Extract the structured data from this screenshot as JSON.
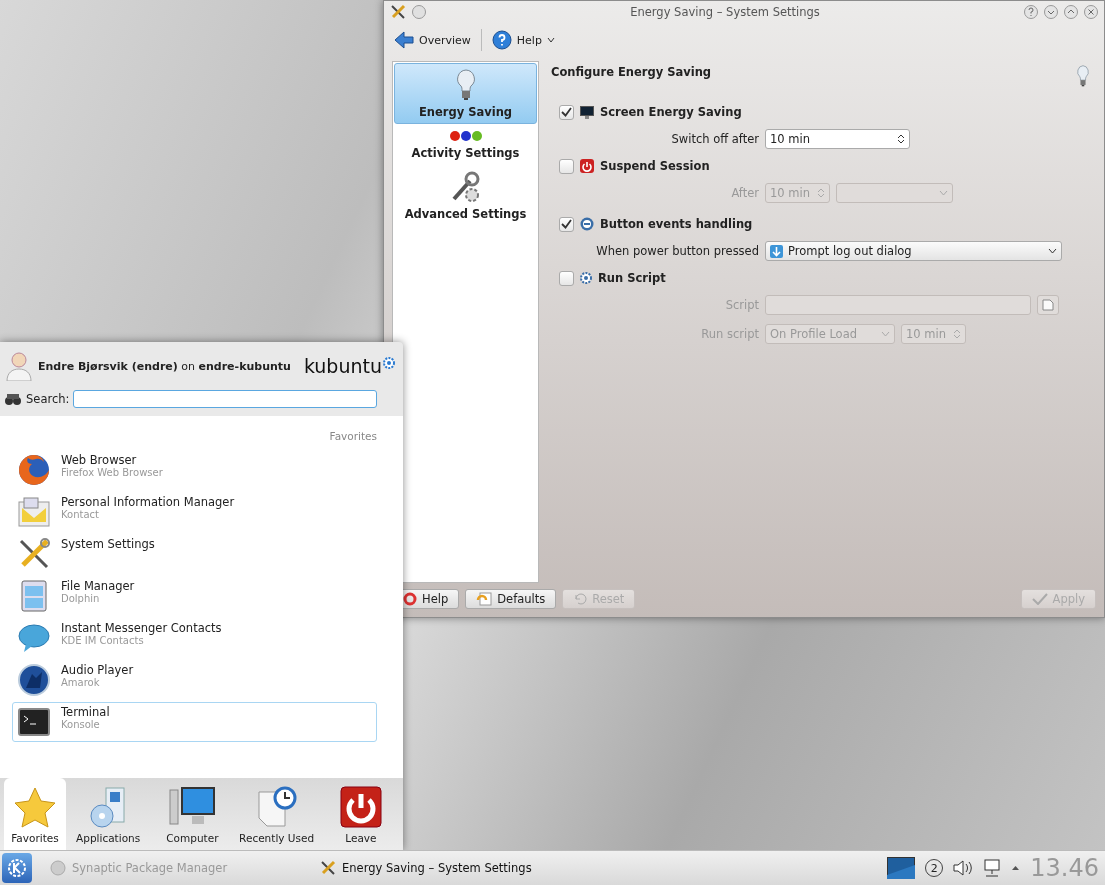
{
  "window": {
    "title": "Energy Saving – System Settings"
  },
  "toolbar": [
    {
      "label": "Overview",
      "kind": "back"
    },
    {
      "label": "Help",
      "kind": "help"
    }
  ],
  "sidebar": {
    "items": [
      {
        "label": "Energy Saving",
        "selected": true
      },
      {
        "label": "Activity Settings",
        "selected": false
      },
      {
        "label": "Advanced Settings",
        "selected": false
      }
    ]
  },
  "content": {
    "heading": "Configure Energy Saving",
    "sections": [
      {
        "label": "Screen Energy Saving",
        "checked": true,
        "rows": [
          {
            "label": "Switch off after",
            "controls": [
              {
                "kind": "spin",
                "value": "10 min"
              }
            ]
          }
        ]
      },
      {
        "label": "Suspend Session",
        "checked": false,
        "rows": [
          {
            "label": "After",
            "controls": [
              {
                "kind": "spin",
                "value": "10 min"
              },
              {
                "kind": "combo"
              }
            ]
          }
        ]
      },
      {
        "label": "Button events handling",
        "checked": true,
        "rows": [
          {
            "label": "When power button pressed",
            "controls": [
              {
                "kind": "icon-combo",
                "value": "Prompt log out dialog"
              }
            ]
          }
        ]
      },
      {
        "label": "Run Script",
        "checked": false,
        "rows": [
          {
            "label": "Script",
            "controls": [
              {
                "kind": "field"
              },
              {
                "kind": "file-button"
              }
            ]
          },
          {
            "label": "Run script",
            "controls": [
              {
                "kind": "combo",
                "value": "On Profile Load"
              },
              {
                "kind": "spin",
                "value": "10 min"
              }
            ]
          }
        ]
      }
    ]
  },
  "buttons": [
    {
      "label": "Help",
      "disabled": false
    },
    {
      "label": "Defaults",
      "disabled": false
    },
    {
      "label": "Reset",
      "disabled": true
    },
    {
      "label": "Apply",
      "disabled": true
    }
  ],
  "launcher": {
    "user_line": "**Endre Bjørsvik (endre)** on **endre-kubuntu**",
    "logo": "kubuntu",
    "search_label": "Search:",
    "section": "Favorites",
    "items": [
      {
        "name": "Web Browser",
        "description": "Firefox Web Browser",
        "selected": false
      },
      {
        "name": "Personal Information Manager",
        "description": "Kontact",
        "selected": false
      },
      {
        "name": "System Settings",
        "selected": false
      },
      {
        "name": "File Manager",
        "description": "Dolphin",
        "selected": false
      },
      {
        "name": "Instant Messenger Contacts",
        "description": "KDE IM Contacts",
        "selected": false
      },
      {
        "name": "Audio Player",
        "description": "Amarok",
        "selected": false
      },
      {
        "name": "Terminal",
        "description": "Konsole",
        "selected": true
      }
    ],
    "tabs": [
      {
        "label": "Favorites",
        "selected": true
      },
      {
        "label": "Applications",
        "selected": false
      },
      {
        "label": "Computer",
        "selected": false
      },
      {
        "label": "Recently Used",
        "selected": false
      },
      {
        "label": "Leave",
        "selected": false
      }
    ]
  },
  "taskbar": {
    "tasks": [
      {
        "label": "Synaptic Package Manager",
        "selected": false
      },
      {
        "label": "Energy Saving – System Settings",
        "selected": true
      }
    ],
    "desktop_number": "2",
    "clock": "13.46"
  }
}
